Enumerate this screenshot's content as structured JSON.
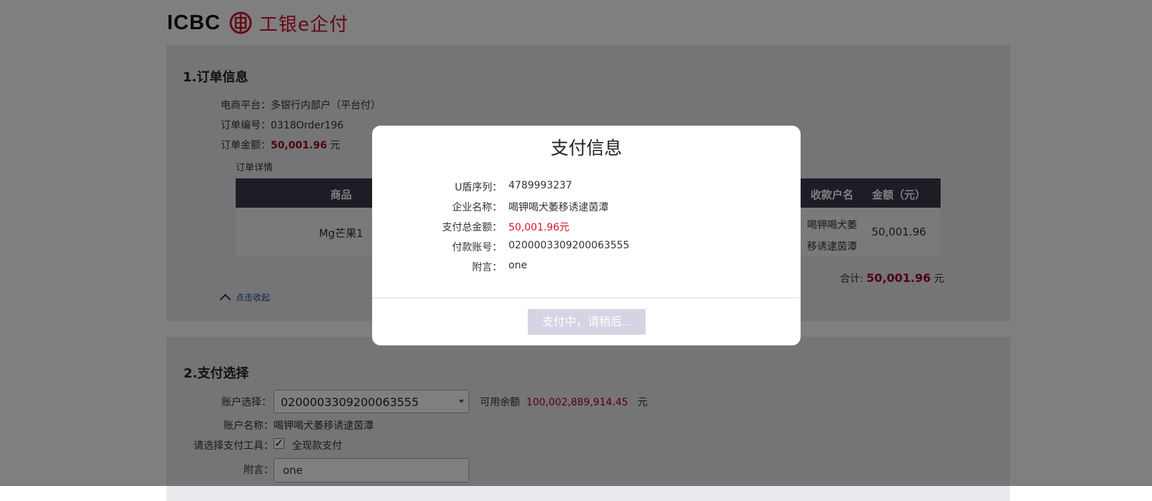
{
  "logo": {
    "brand": "ICBC",
    "name_cn": "工银e企付"
  },
  "order": {
    "title": "1.订单信息",
    "platform_label": "电商平台：",
    "platform_value": "多银行内部户（平台付）",
    "number_label": "订单编号：",
    "number_value": "0318Order196",
    "amount_label": "订单金额：",
    "amount_value": "50,001.96",
    "amount_unit": "元",
    "detail_label": "订单详情",
    "table": {
      "headers": {
        "product": "商品",
        "payee": "收款户名",
        "amount": "金额（元）"
      },
      "rows": [
        {
          "product": "Mg芒果1",
          "payee_line1": "喝钾喝犬萎",
          "payee_line2": "移诱逮茵潭",
          "amount": "50,001.96"
        }
      ]
    },
    "total_label": "合计:",
    "total_value": "50,001.96",
    "total_unit": "元",
    "collapse_label": "点击收起"
  },
  "payment": {
    "title": "2.支付选择",
    "account_label": "账户选择：",
    "account_value": "0200003309200063555",
    "balance_label": "可用余额",
    "balance_value": "100,002,889,914.45",
    "balance_unit": "元",
    "account_name_label": "账户名称：",
    "account_name_value": "喝钾喝犬萎移诱逮茵潭",
    "tool_label": "请选择支付工具：",
    "tool_value": "全现款支付",
    "memo_label": "附言：",
    "memo_value": "one"
  },
  "modal": {
    "title": "支付信息",
    "rows": [
      {
        "label": "U盾序列：",
        "value": "4789993237"
      },
      {
        "label": "企业名称：",
        "value": "喝钾喝犬萎移诱逮茵潭"
      },
      {
        "label": "支付总金额：",
        "value": "50,001.96元"
      },
      {
        "label": "付款账号：",
        "value": "0200003309200063555"
      },
      {
        "label": "附言：",
        "value": "one"
      }
    ],
    "button_label": "支付中，请稍后..."
  },
  "colors": {
    "accent_red": "#a0001e",
    "table_header": "#3a3a4c",
    "panel_bg": "#eaeaee",
    "modal_button": "#d4d4e4"
  },
  "icons": {
    "logo_mark": "icbc-logo-icon",
    "collapse": "chevron-up-icon",
    "dropdown": "caret-down-icon",
    "check": "checkmark-icon"
  }
}
